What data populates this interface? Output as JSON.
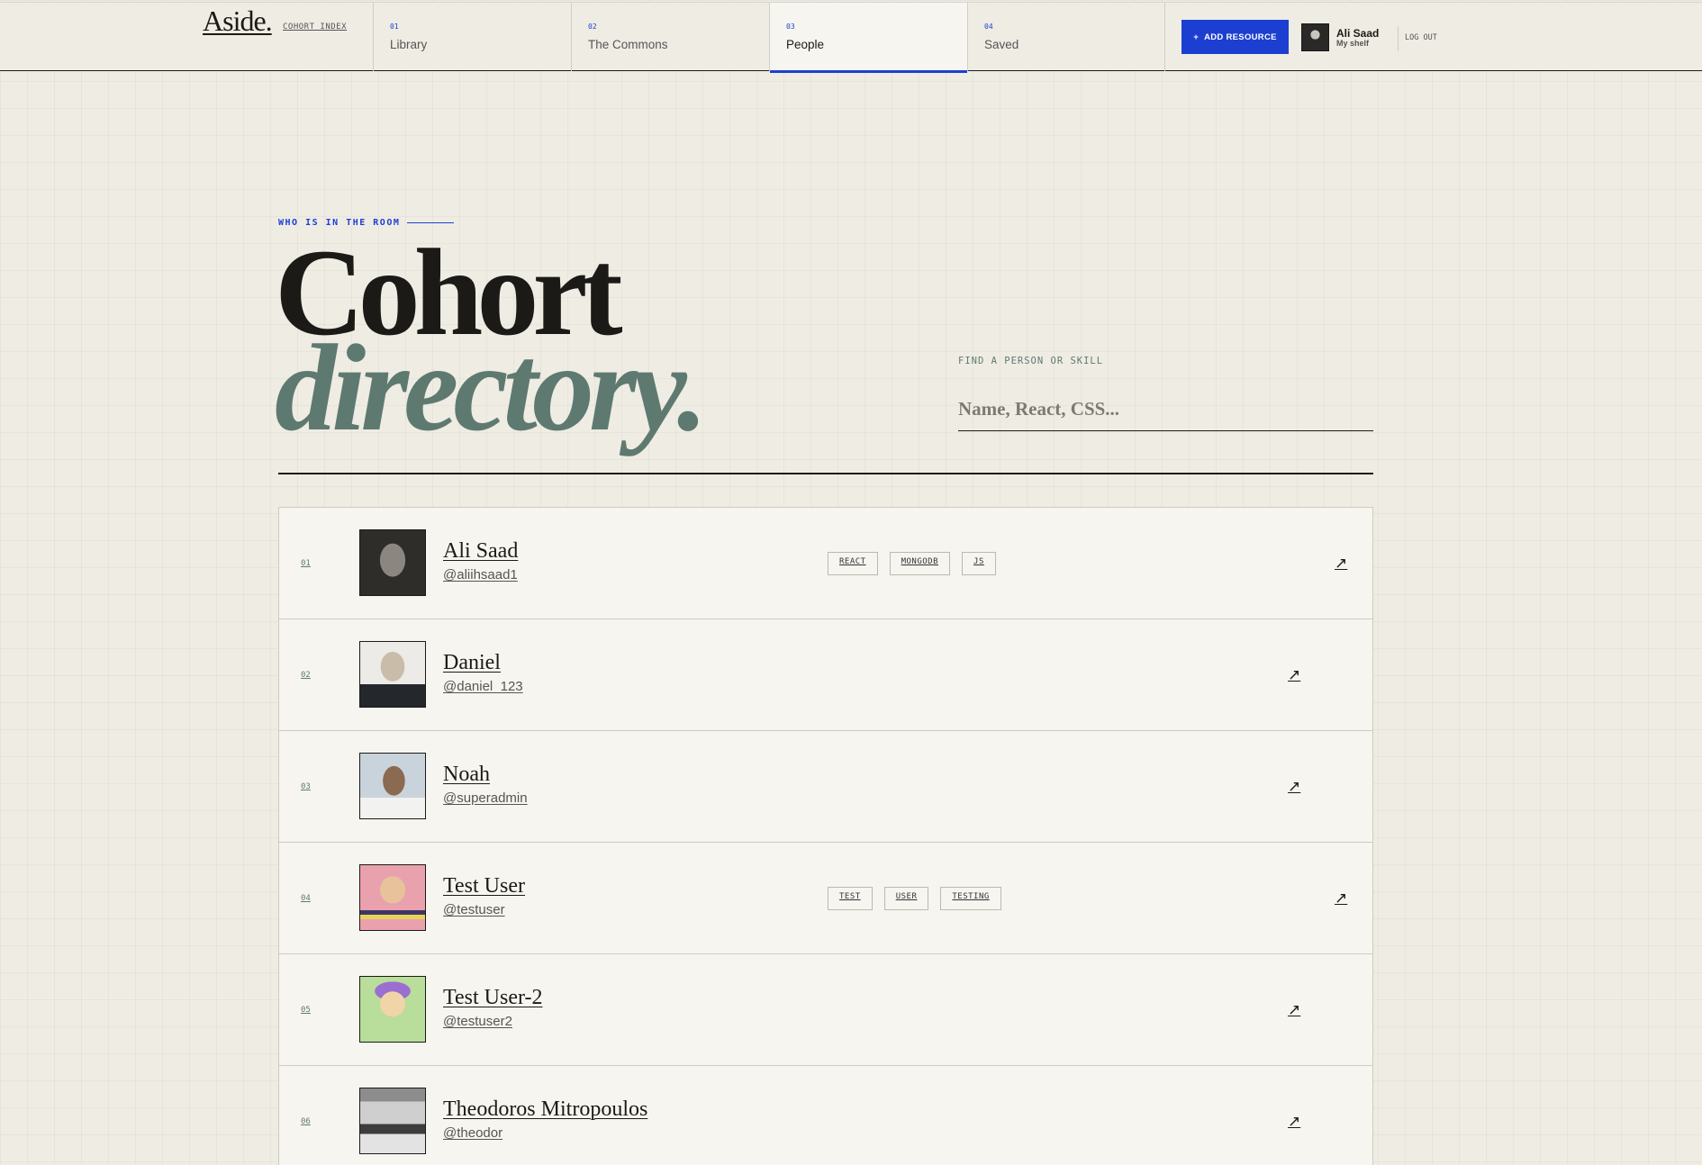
{
  "brand": {
    "logo": "Aside.",
    "index_link": "COHORT INDEX"
  },
  "nav": {
    "tabs": [
      {
        "num": "01",
        "label": "Library"
      },
      {
        "num": "02",
        "label": "The Commons"
      },
      {
        "num": "03",
        "label": "People",
        "active": true
      },
      {
        "num": "04",
        "label": "Saved"
      }
    ],
    "add_button": "ADD RESOURCE",
    "add_icon": "+",
    "user": {
      "name": "Ali Saad",
      "subtitle": "My shelf"
    },
    "logout": "LOG OUT"
  },
  "hero": {
    "eyebrow": "WHO IS IN THE ROOM",
    "title_line1": "Cohort",
    "title_line2": "directory.",
    "search_label": "FIND A PERSON OR SKILL",
    "search_placeholder": "Name, React, CSS..."
  },
  "people": [
    {
      "idx": "01",
      "name": "Ali Saad",
      "handle": "@aliihsaad1",
      "tags": [
        "REACT",
        "MONGODB",
        "JS"
      ],
      "arrow": "↗"
    },
    {
      "idx": "02",
      "name": "Daniel",
      "handle": "@daniel_123",
      "tags": [],
      "arrow": "↗"
    },
    {
      "idx": "03",
      "name": "Noah",
      "handle": "@superadmin",
      "tags": [],
      "arrow": "↗"
    },
    {
      "idx": "04",
      "name": "Test User",
      "handle": "@testuser",
      "tags": [
        "TEST",
        "USER",
        "TESTING"
      ],
      "arrow": "↗"
    },
    {
      "idx": "05",
      "name": "Test User-2",
      "handle": "@testuser2",
      "tags": [],
      "arrow": "↗"
    },
    {
      "idx": "06",
      "name": "Theodoros Mitropoulos",
      "handle": "@theodor",
      "tags": [],
      "arrow": "↗"
    }
  ],
  "colors": {
    "accent": "#1d3fd1",
    "sage": "#5e7a70",
    "ink": "#1b1a17",
    "paper": "#efece4"
  }
}
